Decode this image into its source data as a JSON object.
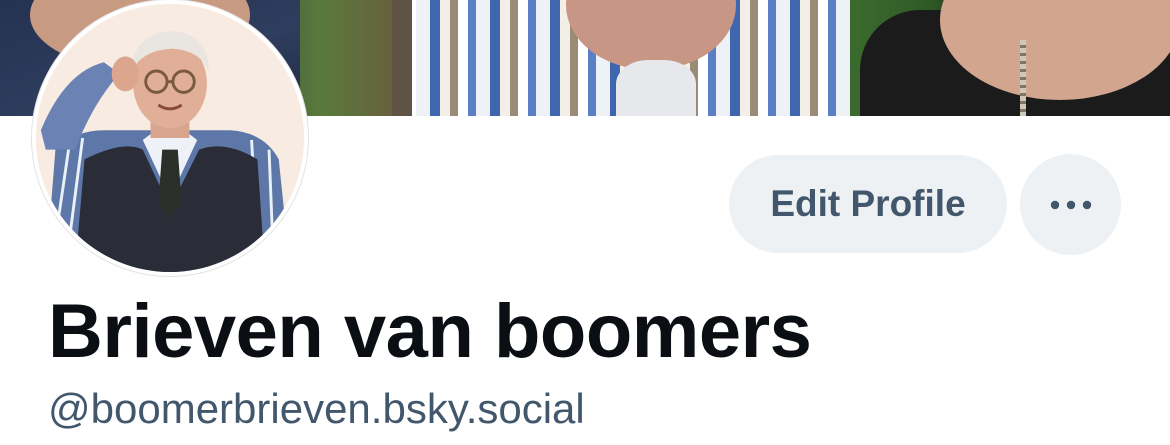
{
  "profile": {
    "display_name": "Brieven van boomers",
    "handle": "@boomerbrieven.bsky.social"
  },
  "actions": {
    "edit_profile_label": "Edit Profile",
    "more_icon": "ellipsis-icon"
  },
  "colors": {
    "button_bg": "#eef1f4",
    "button_text": "#42576c",
    "name_text": "#0b0f14",
    "handle_text": "#42576c",
    "avatar_bg": "#f8ebe1"
  }
}
